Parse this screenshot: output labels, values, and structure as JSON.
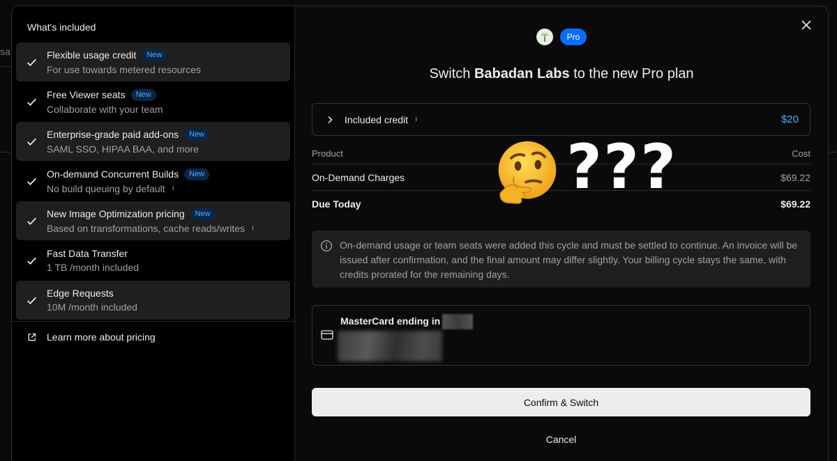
{
  "background": {
    "partial_text": "sa"
  },
  "sidebar": {
    "title": "What's included",
    "features": [
      {
        "title": "Flexible usage credit",
        "badge": "New",
        "desc": "For use towards metered resources"
      },
      {
        "title": "Free Viewer seats",
        "badge": "New",
        "desc": "Collaborate with your team"
      },
      {
        "title": "Enterprise-grade paid add-ons",
        "badge": "New",
        "desc": "SAML SSO, HIPAA BAA, and more"
      },
      {
        "title": "On-demand Concurrent Builds",
        "badge": "New",
        "desc": "No build queuing by default"
      },
      {
        "title": "New Image Optimization pricing",
        "badge": "New",
        "desc": "Based on transformations, cache reads/writes"
      },
      {
        "title": "Fast Data Transfer",
        "badge": "",
        "desc": "1 TB /month included"
      },
      {
        "title": "Edge Requests",
        "badge": "",
        "desc": "10M /month included"
      }
    ],
    "learn_more": "Learn more about pricing",
    "info_glyph": "i"
  },
  "header": {
    "plan_badge": "Pro",
    "title_prefix": "Switch ",
    "team_name": "Babadan Labs",
    "title_suffix": " to the new Pro plan"
  },
  "credit": {
    "label": "Included credit",
    "amount": "$20"
  },
  "table": {
    "columns": [
      "Product",
      "Cost"
    ],
    "rows": [
      {
        "product": "On-Demand Charges",
        "cost": "$69.22"
      }
    ],
    "total": {
      "label": "Due Today",
      "amount": "$69.22"
    }
  },
  "notice": {
    "text": "On-demand usage or team seats were added this cycle and must be settled to continue. An invoice will be issued after confirmation, and the final amount may differ slightly. Your billing cycle stays the same, with credits prorated for the remaining days."
  },
  "payment": {
    "label": "MasterCard ending in"
  },
  "actions": {
    "confirm": "Confirm & Switch",
    "cancel": "Cancel"
  },
  "overlay": {
    "text": "???"
  },
  "colors": {
    "accent": "#0a6dff",
    "link_blue": "#52a8ff",
    "panel": "#1f1f1f",
    "button_bg": "#ededed"
  }
}
